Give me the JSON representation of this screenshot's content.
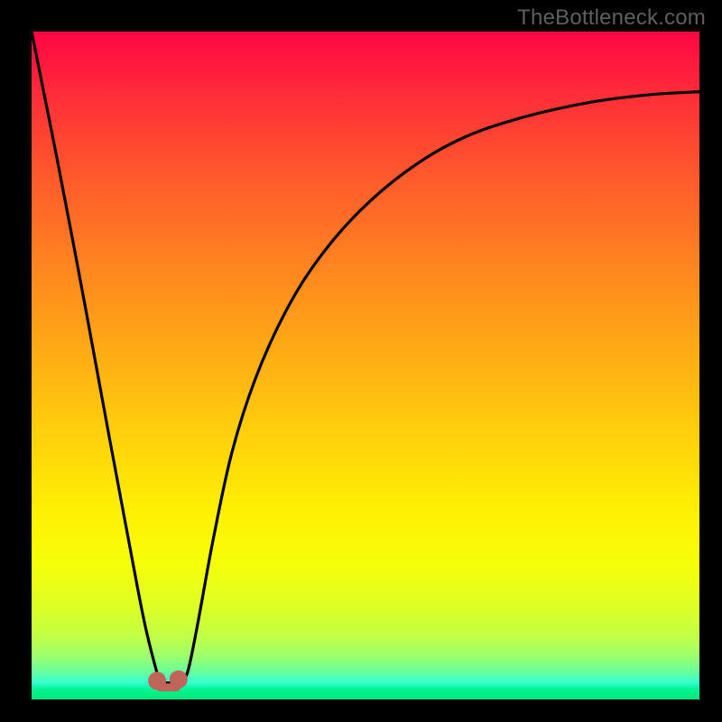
{
  "watermark": {
    "text": "TheBottleneck.com"
  },
  "gradient": {
    "stops": [
      {
        "offset": 0.0,
        "color": "#ff0643"
      },
      {
        "offset": 0.1,
        "color": "#ff2f38"
      },
      {
        "offset": 0.22,
        "color": "#ff5a2b"
      },
      {
        "offset": 0.35,
        "color": "#ff8420"
      },
      {
        "offset": 0.48,
        "color": "#ffab15"
      },
      {
        "offset": 0.6,
        "color": "#ffcf0c"
      },
      {
        "offset": 0.72,
        "color": "#fff004"
      },
      {
        "offset": 0.8,
        "color": "#f5ff0a"
      },
      {
        "offset": 0.86,
        "color": "#deff24"
      },
      {
        "offset": 0.905,
        "color": "#c2ff45"
      },
      {
        "offset": 0.935,
        "color": "#9cff6d"
      },
      {
        "offset": 0.958,
        "color": "#6aff9c"
      },
      {
        "offset": 0.975,
        "color": "#36ffd0"
      },
      {
        "offset": 0.985,
        "color": "#00f490"
      },
      {
        "offset": 1.0,
        "color": "#00e876"
      }
    ]
  },
  "chart_data": {
    "type": "line",
    "title": "",
    "xlabel": "",
    "ylabel": "",
    "xlim": [
      0,
      1
    ],
    "ylim": [
      0,
      1
    ],
    "note": "x and y are normalized 0..1 over the plot area; y is the curve height (0=bottom, 1=top). The displayed curve is a black V-shape: near-vertical descent from top-left toward x≈0.20, a tiny flat basin at the bottom, then a concave rise toward the right edge.",
    "series": [
      {
        "name": "bottleneck-curve",
        "x": [
          0.0,
          0.04,
          0.08,
          0.115,
          0.145,
          0.168,
          0.185,
          0.192,
          0.2,
          0.21,
          0.22,
          0.228,
          0.236,
          0.25,
          0.272,
          0.3,
          0.335,
          0.38,
          0.43,
          0.49,
          0.56,
          0.64,
          0.73,
          0.83,
          0.92,
          1.0
        ],
        "y": [
          1.0,
          0.8,
          0.59,
          0.4,
          0.24,
          0.12,
          0.05,
          0.03,
          0.025,
          0.025,
          0.025,
          0.03,
          0.05,
          0.12,
          0.24,
          0.37,
          0.48,
          0.58,
          0.66,
          0.73,
          0.79,
          0.838,
          0.87,
          0.893,
          0.905,
          0.91
        ]
      }
    ],
    "markers": {
      "color": "#c1645a",
      "radius_norm": 0.0135,
      "x": [
        0.188,
        0.22
      ],
      "y": [
        0.028,
        0.03
      ]
    },
    "basin_bar": {
      "color": "#c1645a",
      "x0": 0.188,
      "x1": 0.222,
      "y0": 0.012,
      "y1": 0.024
    }
  }
}
